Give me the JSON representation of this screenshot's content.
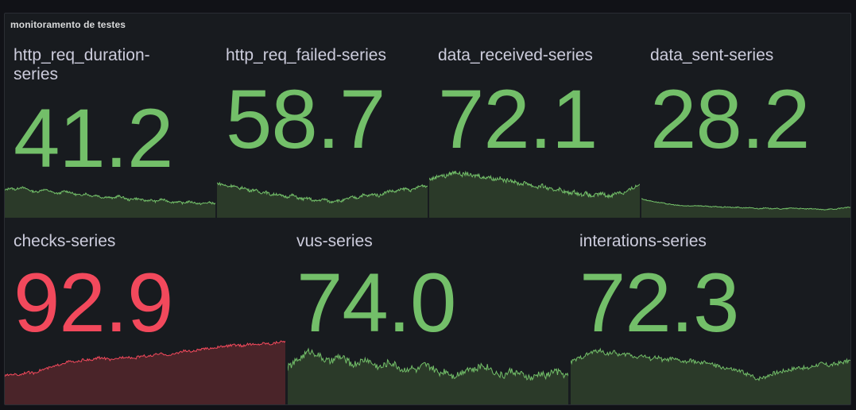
{
  "panel": {
    "title": "monitoramento de testes"
  },
  "colors": {
    "green": "#73bf69",
    "green_fill": "#2b3a29",
    "red": "#f2495c",
    "red_fill": "#4a2429"
  },
  "stats": [
    {
      "title": "http_req_duration-series",
      "value": "41.2",
      "status": "green",
      "sparkline": [
        0.42,
        0.45,
        0.43,
        0.46,
        0.44,
        0.41,
        0.4,
        0.43,
        0.42,
        0.39,
        0.38,
        0.41,
        0.4,
        0.37,
        0.36,
        0.38,
        0.35,
        0.36,
        0.33,
        0.34,
        0.32,
        0.35,
        0.33,
        0.3,
        0.32,
        0.31,
        0.29,
        0.3,
        0.28,
        0.31,
        0.29,
        0.27,
        0.28,
        0.26,
        0.28,
        0.27,
        0.25,
        0.26,
        0.27,
        0.25
      ]
    },
    {
      "title": "http_req_failed-series",
      "value": "58.7",
      "status": "green",
      "sparkline": [
        0.45,
        0.44,
        0.42,
        0.43,
        0.4,
        0.41,
        0.38,
        0.39,
        0.36,
        0.37,
        0.34,
        0.35,
        0.33,
        0.32,
        0.34,
        0.31,
        0.3,
        0.31,
        0.28,
        0.29,
        0.3,
        0.27,
        0.29,
        0.28,
        0.3,
        0.32,
        0.31,
        0.34,
        0.33,
        0.35,
        0.33,
        0.36,
        0.38,
        0.37,
        0.39,
        0.4,
        0.38,
        0.41,
        0.43,
        0.42
      ]
    },
    {
      "title": "data_received-series",
      "value": "72.1",
      "status": "green",
      "sparkline": [
        0.55,
        0.56,
        0.58,
        0.57,
        0.59,
        0.6,
        0.58,
        0.59,
        0.57,
        0.58,
        0.56,
        0.57,
        0.55,
        0.56,
        0.54,
        0.55,
        0.53,
        0.52,
        0.53,
        0.51,
        0.5,
        0.51,
        0.49,
        0.48,
        0.49,
        0.47,
        0.46,
        0.47,
        0.45,
        0.46,
        0.44,
        0.45,
        0.46,
        0.44,
        0.45,
        0.47,
        0.46,
        0.48,
        0.5,
        0.52
      ]
    },
    {
      "title": "data_sent-series",
      "value": "28.2",
      "status": "green",
      "sparkline": [
        0.4,
        0.36,
        0.33,
        0.3,
        0.28,
        0.25,
        0.23,
        0.21,
        0.2,
        0.19,
        0.21,
        0.2,
        0.19,
        0.17,
        0.18,
        0.16,
        0.17,
        0.15,
        0.16,
        0.14,
        0.15,
        0.13,
        0.12,
        0.14,
        0.12,
        0.13,
        0.11,
        0.12,
        0.14,
        0.13,
        0.12,
        0.11,
        0.12,
        0.1,
        0.09,
        0.11,
        0.1,
        0.13,
        0.15,
        0.16
      ]
    },
    {
      "title": "checks-series",
      "value": "92.9",
      "status": "red",
      "sparkline": [
        0.42,
        0.44,
        0.43,
        0.46,
        0.45,
        0.48,
        0.5,
        0.52,
        0.55,
        0.57,
        0.56,
        0.59,
        0.58,
        0.61,
        0.6,
        0.58,
        0.61,
        0.62,
        0.6,
        0.63,
        0.62,
        0.64,
        0.65,
        0.63,
        0.66,
        0.68,
        0.67,
        0.69,
        0.7,
        0.71,
        0.72,
        0.73,
        0.74,
        0.73,
        0.75,
        0.74,
        0.76,
        0.75,
        0.77,
        0.78
      ]
    },
    {
      "title": "vus-series",
      "value": "74.0",
      "status": "green",
      "sparkline": [
        0.58,
        0.6,
        0.62,
        0.64,
        0.63,
        0.61,
        0.6,
        0.62,
        0.61,
        0.59,
        0.6,
        0.61,
        0.59,
        0.58,
        0.6,
        0.59,
        0.57,
        0.58,
        0.57,
        0.59,
        0.58,
        0.56,
        0.57,
        0.55,
        0.56,
        0.58,
        0.57,
        0.59,
        0.58,
        0.56,
        0.55,
        0.57,
        0.56,
        0.55,
        0.54,
        0.56,
        0.55,
        0.57,
        0.56,
        0.55
      ]
    },
    {
      "title": "interations-series",
      "value": "72.3",
      "status": "green",
      "sparkline": [
        0.58,
        0.6,
        0.62,
        0.64,
        0.65,
        0.63,
        0.64,
        0.62,
        0.63,
        0.61,
        0.62,
        0.6,
        0.61,
        0.59,
        0.6,
        0.59,
        0.58,
        0.59,
        0.57,
        0.58,
        0.56,
        0.55,
        0.54,
        0.53,
        0.52,
        0.5,
        0.48,
        0.49,
        0.51,
        0.52,
        0.53,
        0.54,
        0.55,
        0.54,
        0.56,
        0.57,
        0.56,
        0.57,
        0.58,
        0.59
      ]
    }
  ]
}
